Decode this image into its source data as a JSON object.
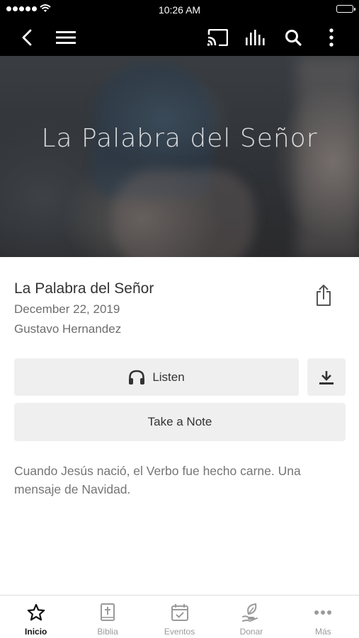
{
  "status_bar": {
    "time": "10:26 AM"
  },
  "nav_bar": {
    "icons": [
      "chevron-left-icon",
      "hamburger-menu-icon",
      "cast-icon",
      "audio-bars-icon",
      "search-icon",
      "more-vertical-icon"
    ]
  },
  "hero": {
    "title": "La Palabra del Señor"
  },
  "sermon": {
    "title": "La Palabra del Señor",
    "date": "December 22, 2019",
    "speaker": "Gustavo Hernandez",
    "description": "Cuando Jesús nació, el Verbo fue hecho carne. Una mensaje de Navidad."
  },
  "actions": {
    "listen_label": "Listen",
    "note_label": "Take a Note"
  },
  "tab_bar": {
    "active": "Inicio",
    "tabs": [
      {
        "label": "Inicio",
        "icon": "star-icon"
      },
      {
        "label": "Biblia",
        "icon": "bible-icon"
      },
      {
        "label": "Eventos",
        "icon": "calendar-check-icon"
      },
      {
        "label": "Donar",
        "icon": "leaf-hand-icon"
      },
      {
        "label": "Más",
        "icon": "more-horizontal-icon"
      }
    ]
  },
  "colors": {
    "nav_background": "#000000",
    "button_background": "#efefef",
    "tab_active": "#111111",
    "tab_inactive": "#9a9a9a"
  }
}
